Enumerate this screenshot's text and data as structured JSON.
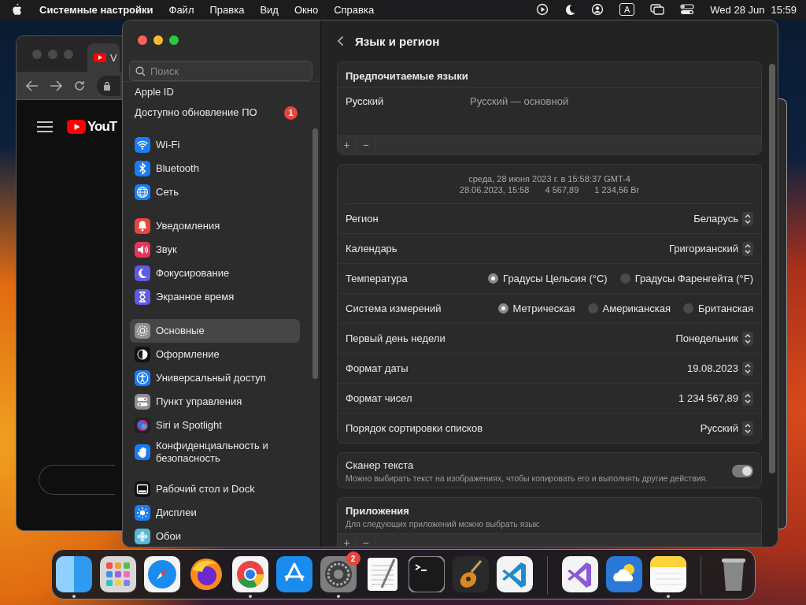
{
  "menu_bar": {
    "app_name": "Системные настройки",
    "menus": [
      "Файл",
      "Правка",
      "Вид",
      "Окно",
      "Справка"
    ],
    "input_source": "A",
    "date": "Wed 28 Jun",
    "time": "15:59"
  },
  "browser": {
    "tab_title": "V",
    "logo_text": "YouT"
  },
  "settings": {
    "search": {
      "placeholder": "Поиск"
    },
    "sidebar": {
      "groups": [
        {
          "items": [
            {
              "label": "Apple ID",
              "selected": false
            },
            {
              "label": "Доступно обновление ПО",
              "badge": "1",
              "selected": false
            }
          ]
        },
        {
          "items": [
            {
              "label": "Wi-Fi",
              "selected": false
            },
            {
              "label": "Bluetooth",
              "selected": false
            },
            {
              "label": "Сеть",
              "selected": false
            }
          ]
        },
        {
          "items": [
            {
              "label": "Уведомления",
              "selected": false
            },
            {
              "label": "Звук",
              "selected": false
            },
            {
              "label": "Фокусирование",
              "selected": false
            },
            {
              "label": "Экранное время",
              "selected": false
            }
          ]
        },
        {
          "items": [
            {
              "label": "Основные",
              "selected": true
            },
            {
              "label": "Оформление",
              "selected": false
            },
            {
              "label": "Универсальный доступ",
              "selected": false
            },
            {
              "label": "Пункт управления",
              "selected": false
            },
            {
              "label": "Siri и Spotlight",
              "selected": false
            },
            {
              "label": "Конфиденциальность и безопасность",
              "selected": false
            }
          ]
        },
        {
          "items": [
            {
              "label": "Рабочий стол и Dock",
              "selected": false
            },
            {
              "label": "Дисплеи",
              "selected": false
            },
            {
              "label": "Обои",
              "selected": false
            }
          ]
        }
      ]
    },
    "title": "Язык и регион",
    "preferred_languages": {
      "title": "Предпочитаемые языки",
      "languages": [
        {
          "name": "Русский",
          "detail": "Русский — основной"
        }
      ],
      "buttons": [
        "+",
        "−"
      ]
    },
    "format_preview": {
      "lines": [
        [
          "среда, 28 июня 2023 г. в 15:58:37 GMT-4"
        ],
        [
          "28.06.2023, 15:58",
          "4 567,89",
          "1 234,56 Br"
        ]
      ]
    },
    "region_settings": {
      "rows": [
        {
          "kind": "popup",
          "label": "Регион",
          "value": "Беларусь"
        },
        {
          "kind": "popup",
          "label": "Календарь",
          "value": "Григорианский"
        },
        {
          "kind": "radio",
          "label": "Температура",
          "options": [
            {
              "label": "Градусы Цельсия (°C)",
              "selected": true
            },
            {
              "label": "Градусы Фаренгейта (°F)",
              "selected": false
            }
          ]
        },
        {
          "kind": "radio",
          "label": "Система измерений",
          "options": [
            {
              "label": "Метрическая",
              "selected": true
            },
            {
              "label": "Американская",
              "selected": false
            },
            {
              "label": "Британская",
              "selected": false
            }
          ]
        },
        {
          "kind": "popup",
          "label": "Первый день недели",
          "value": "Понедельник"
        },
        {
          "kind": "popup",
          "label": "Формат даты",
          "value": "19.08.2023"
        },
        {
          "kind": "popup",
          "label": "Формат чисел",
          "value": "1 234 567,89"
        },
        {
          "kind": "popup",
          "label": "Порядок сортировки списков",
          "value": "Русский"
        }
      ]
    },
    "text_scanner": {
      "title": "Сканер текста",
      "description": "Можно выбирать текст на изображениях, чтобы копировать его и выполнять другие действия.",
      "on": true
    },
    "applications": {
      "title": "Приложения",
      "description": "Для следующих приложений можно выбрать язык:",
      "buttons": [
        "+",
        "−"
      ]
    }
  },
  "dock": {
    "items": [
      {
        "kind": "finder",
        "running": true
      },
      {
        "kind": "launchpad",
        "running": false
      },
      {
        "kind": "safari",
        "running": false
      },
      {
        "kind": "firefox",
        "running": false
      },
      {
        "kind": "chrome",
        "running": true
      },
      {
        "kind": "appstore",
        "running": false
      },
      {
        "kind": "settings",
        "running": true,
        "badge": "2"
      },
      {
        "kind": "textedit",
        "running": false
      },
      {
        "kind": "terminal",
        "running": false
      },
      {
        "kind": "garageband",
        "running": false
      },
      {
        "kind": "vscode",
        "running": false
      },
      {
        "kind": "separator"
      },
      {
        "kind": "visualstudio",
        "running": false
      },
      {
        "kind": "weather",
        "running": false
      },
      {
        "kind": "notes",
        "running": true
      },
      {
        "kind": "separator"
      },
      {
        "kind": "trash",
        "running": false
      }
    ]
  }
}
